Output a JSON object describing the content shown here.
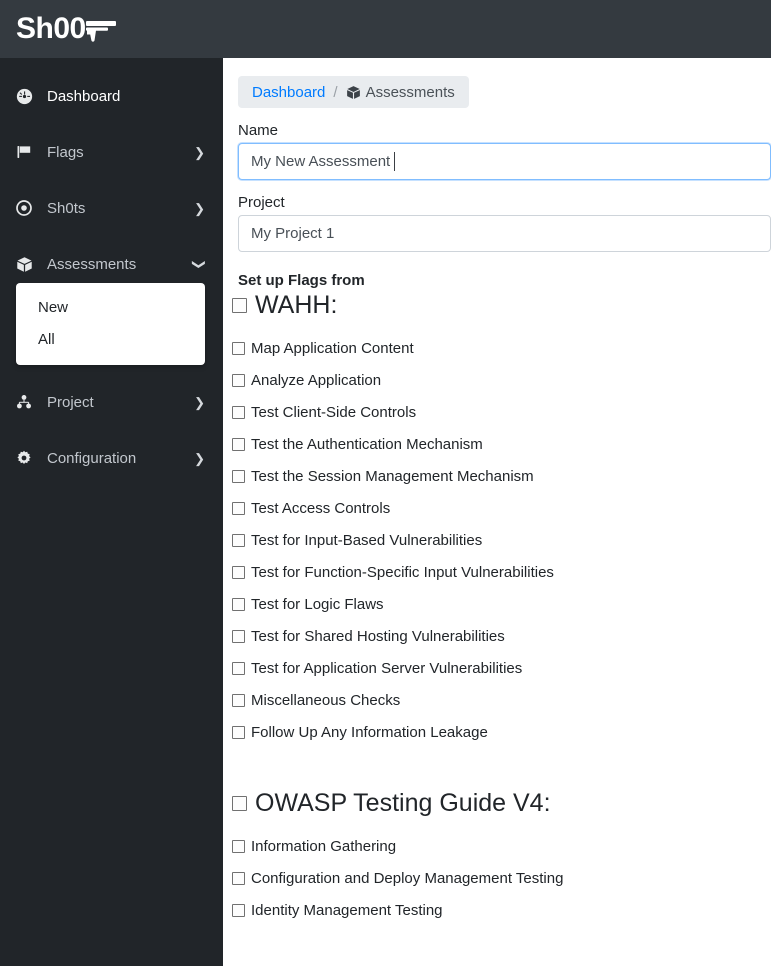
{
  "brand": {
    "text_a": "Sh",
    "text_b": "00",
    "logo_name": "shoot-logo",
    "gun_icon": "pistol-icon"
  },
  "sidebar": {
    "items": [
      {
        "label": "Dashboard",
        "icon": "tachometer-icon",
        "caret": "",
        "active": true
      },
      {
        "label": "Flags",
        "icon": "flag-icon",
        "caret": "❯",
        "active": false
      },
      {
        "label": "Sh0ts",
        "icon": "bullseye-icon",
        "caret": "❯",
        "active": false
      },
      {
        "label": "Assessments",
        "icon": "box-icon",
        "caret": "❯",
        "active": false
      },
      {
        "label": "Project",
        "icon": "sitemap-icon",
        "caret": "❯",
        "active": false
      },
      {
        "label": "Configuration",
        "icon": "cog-icon",
        "caret": "❯",
        "active": false
      }
    ],
    "submenu": {
      "parent": "Assessments",
      "items": [
        {
          "label": "New"
        },
        {
          "label": "All"
        }
      ]
    }
  },
  "breadcrumb": {
    "root_label": "Dashboard",
    "separator": "/",
    "current_label": "Assessments",
    "current_icon": "box-icon",
    "background": "#e9ecef",
    "link_color": "#007bff"
  },
  "form": {
    "name_label": "Name",
    "name_value": "My New Assessment ",
    "name_placeholder": "Name",
    "name_focused": true,
    "project_label": "Project",
    "project_value": "My Project 1",
    "project_placeholder": "Project",
    "focus_border_color": "#80bdff",
    "border_color": "#ced4da"
  },
  "setup": {
    "title": "Set up Flags from",
    "groups": [
      {
        "name": "WAHH:",
        "checked": false,
        "items": [
          {
            "label": "Map Application Content",
            "checked": false
          },
          {
            "label": "Analyze Application",
            "checked": false
          },
          {
            "label": "Test Client-Side Controls",
            "checked": false
          },
          {
            "label": "Test the Authentication Mechanism",
            "checked": false
          },
          {
            "label": "Test the Session Management Mechanism",
            "checked": false
          },
          {
            "label": "Test Access Controls",
            "checked": false
          },
          {
            "label": "Test for Input-Based Vulnerabilities",
            "checked": false
          },
          {
            "label": "Test for Function-Specific Input Vulnerabilities",
            "checked": false
          },
          {
            "label": "Test for Logic Flaws",
            "checked": false
          },
          {
            "label": "Test for Shared Hosting Vulnerabilities",
            "checked": false
          },
          {
            "label": "Test for Application Server Vulnerabilities",
            "checked": false
          },
          {
            "label": "Miscellaneous Checks",
            "checked": false
          },
          {
            "label": "Follow Up Any Information Leakage",
            "checked": false
          }
        ]
      },
      {
        "name": "OWASP Testing Guide V4:",
        "checked": false,
        "items": [
          {
            "label": "Information Gathering",
            "checked": false
          },
          {
            "label": "Configuration and Deploy Management Testing",
            "checked": false
          },
          {
            "label": "Identity Management Testing",
            "checked": false
          }
        ]
      }
    ]
  },
  "colors": {
    "sidebar_bg": "#212529",
    "header_bg": "#343a40",
    "sidebar_text": "#c2c7cd",
    "content_bg": "#ffffff"
  }
}
